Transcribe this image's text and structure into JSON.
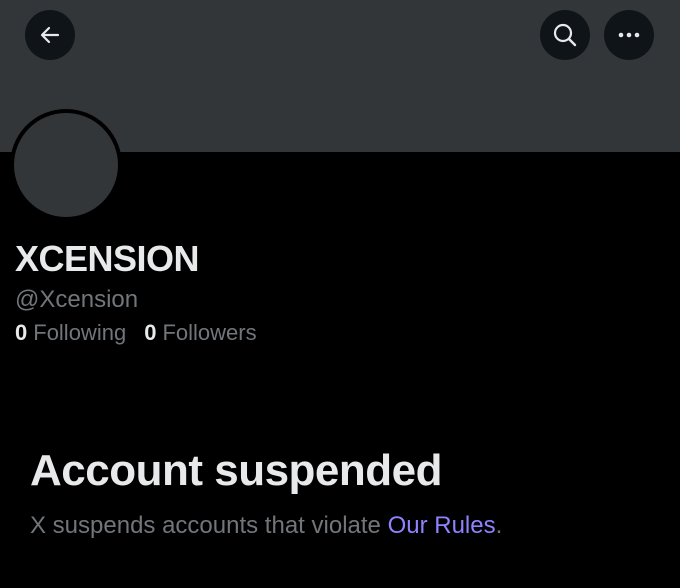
{
  "header": {
    "back_icon": "arrow-left-icon",
    "search_icon": "search-icon",
    "more_icon": "more-horizontal-icon"
  },
  "profile": {
    "display_name": "XCENSION",
    "handle": "@Xcension",
    "following_count": "0",
    "following_label": "Following",
    "followers_count": "0",
    "followers_label": "Followers"
  },
  "notice": {
    "title": "Account suspended",
    "text_before": "X suspends accounts that violate ",
    "link_text": "Our Rules",
    "text_after": "."
  },
  "colors": {
    "background": "#000000",
    "banner": "#333639",
    "button_bg": "#0f1419",
    "primary_text": "#e7e9ea",
    "secondary_text": "#71767b",
    "link": "#8e82ff"
  }
}
